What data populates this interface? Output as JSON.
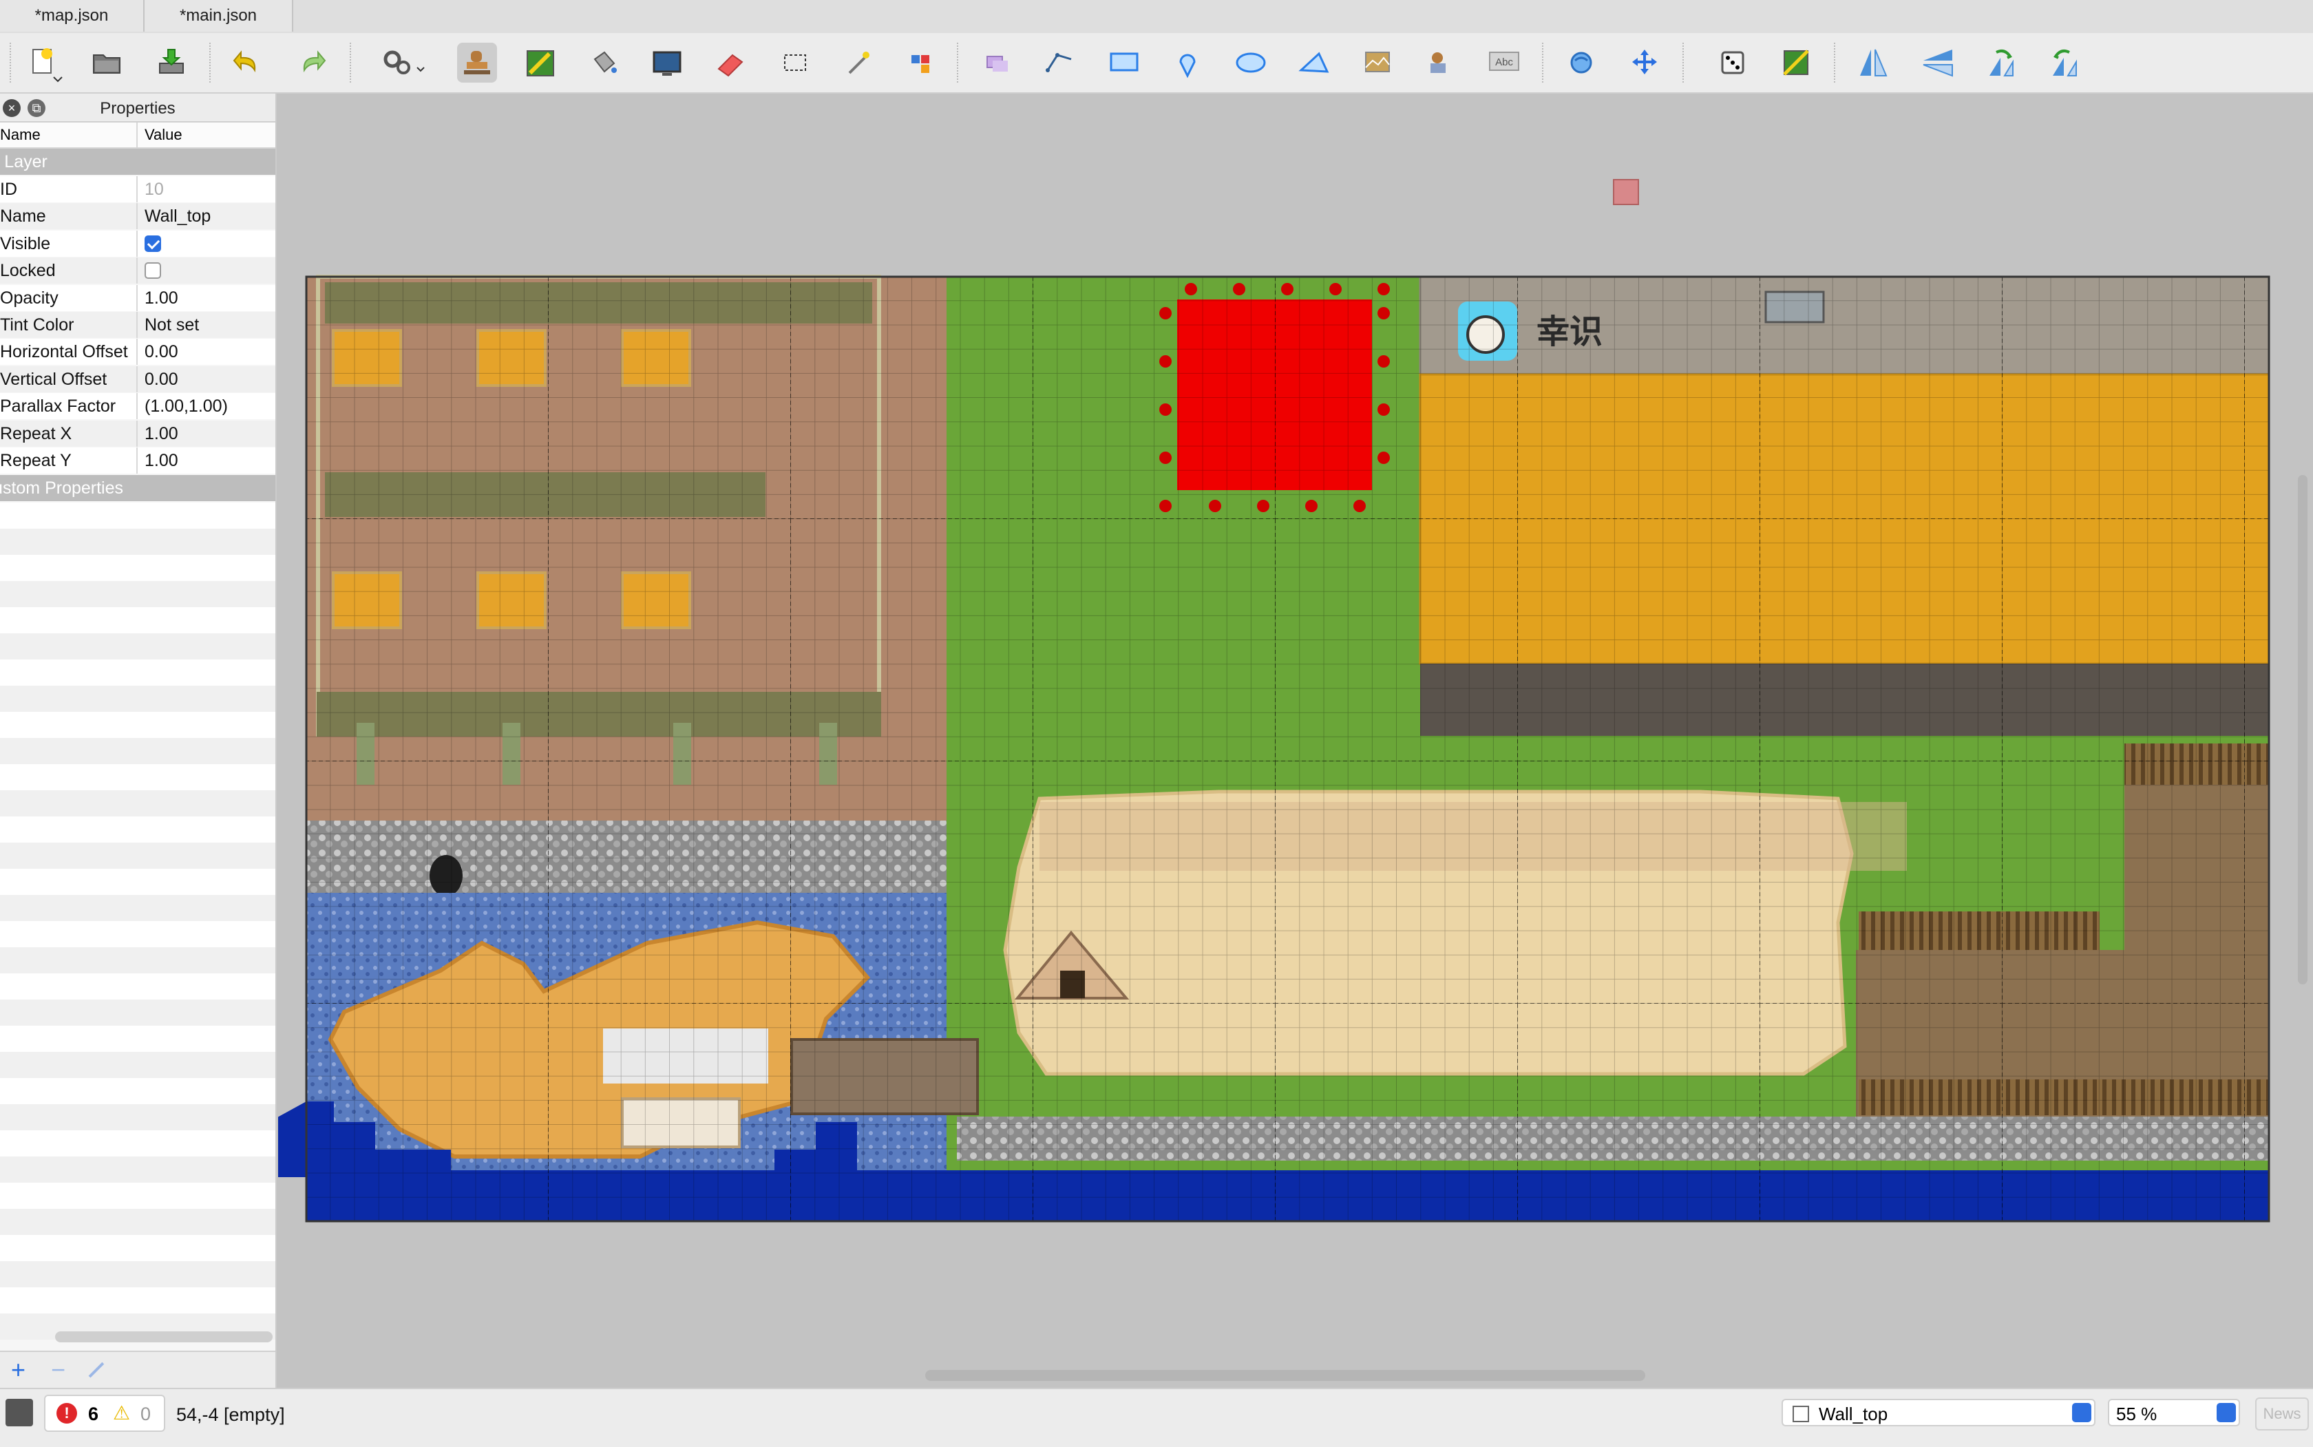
{
  "tabs": [
    {
      "label": "*map.json"
    },
    {
      "label": "*main.json"
    }
  ],
  "toolbar": {
    "icons": [
      "new-map",
      "open",
      "save",
      "undo",
      "redo",
      "commands",
      "stamp-brush",
      "terrain-brush",
      "bucket-fill",
      "shape-fill",
      "eraser",
      "rectangular-select",
      "magic-wand",
      "select-same-tile",
      "select-objects",
      "edit-polygons",
      "insert-rectangle",
      "insert-point",
      "insert-ellipse",
      "insert-polygon",
      "insert-tile",
      "insert-template",
      "insert-text",
      "world-tool",
      "move-tool",
      "random-mode",
      "wang-fill",
      "flip-horizontal",
      "flip-vertical",
      "rotate-left",
      "rotate-right"
    ]
  },
  "properties_panel": {
    "title": "Properties",
    "col_name": "Name",
    "col_value": "Value",
    "section_layer": "Tile Layer",
    "rows": [
      {
        "key": "ID",
        "value": "10",
        "disabled": true
      },
      {
        "key": "Name",
        "value": "Wall_top"
      },
      {
        "key": "Visible",
        "value": "",
        "checkbox": true,
        "checked": true
      },
      {
        "key": "Locked",
        "value": "",
        "checkbox": true,
        "checked": false
      },
      {
        "key": "Opacity",
        "value": "1.00"
      },
      {
        "key": "Tint Color",
        "value": "Not set"
      },
      {
        "key": "Horizontal Offset",
        "value": "0.00"
      },
      {
        "key": "Vertical Offset",
        "value": "0.00"
      },
      {
        "key": "Parallax Factor",
        "value": "(1.00,1.00)"
      },
      {
        "key": "Repeat X",
        "value": "1.00"
      },
      {
        "key": "Repeat Y",
        "value": "1.00"
      }
    ],
    "section_custom": "Custom Properties"
  },
  "map": {
    "sign_text": "幸识"
  },
  "statusbar": {
    "errors": "6",
    "warnings": "0",
    "coords": "54,-4 [empty]",
    "layer": "Wall_top",
    "zoom": "55 %",
    "news": "News"
  },
  "colors": {
    "grass": "#6aa638",
    "dirt": "#b0866b",
    "carpet": "#e2a21e",
    "red_stage": "#ef0000",
    "deep_water": "#0b2aa7",
    "sand": "#ecd6a6"
  }
}
